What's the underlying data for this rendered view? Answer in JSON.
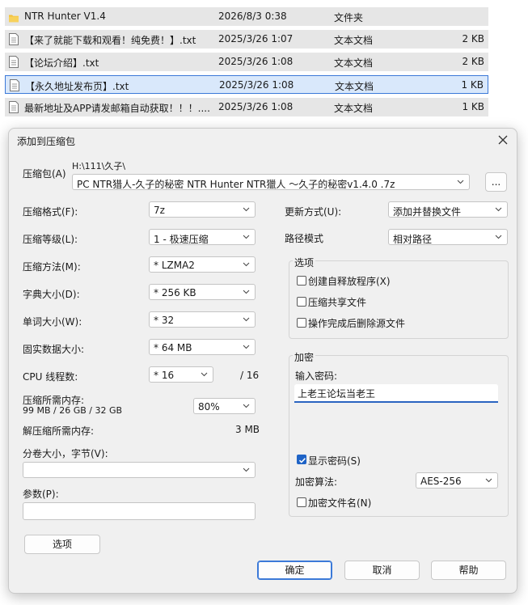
{
  "files": [
    {
      "name": "NTR Hunter V1.4",
      "date": "2026/8/3 0:38",
      "type": "文件夹",
      "size": "",
      "icon": "folder-icon"
    },
    {
      "name": "【来了就能下载和观看！纯免费！】.txt",
      "date": "2025/3/26 1:07",
      "type": "文本文档",
      "size": "2 KB",
      "icon": "text-file-icon"
    },
    {
      "name": "【论坛介绍】.txt",
      "date": "2025/3/26 1:08",
      "type": "文本文档",
      "size": "2 KB",
      "icon": "text-file-icon"
    },
    {
      "name": "【永久地址发布页】.txt",
      "date": "2025/3/26 1:08",
      "type": "文本文档",
      "size": "1 KB",
      "icon": "text-file-icon"
    },
    {
      "name": "最新地址及APP请发邮箱自动获取！！！....",
      "date": "2025/3/26 1:08",
      "type": "文本文档",
      "size": "1 KB",
      "icon": "text-file-icon"
    }
  ],
  "dialog": {
    "title": "添加到压缩包",
    "archive_label": "压缩包(A)",
    "archive_path": "H:\\111\\久子\\",
    "archive_name": "PC NTR猎人-久子的秘密 NTR Hunter NTR獵人 ～久子的秘密v1.4.0 .7z",
    "browse_label": "...",
    "format_label": "压缩格式(F):",
    "format_value": "7z",
    "level_label": "压缩等级(L):",
    "level_value": "1 - 极速压缩",
    "method_label": "压缩方法(M):",
    "method_value": "* LZMA2",
    "dict_label": "字典大小(D):",
    "dict_value": "* 256 KB",
    "word_label": "单词大小(W):",
    "word_value": "* 32",
    "solid_label": "固实数据大小:",
    "solid_value": "* 64 MB",
    "threads_label": "CPU 线程数:",
    "threads_value": "* 16",
    "threads_max": "/ 16",
    "mem_label": "压缩所需内存:",
    "mem_value": "99 MB / 26 GB / 32 GB",
    "mem_percent": "80%",
    "decomp_label": "解压缩所需内存:",
    "decomp_value": "3 MB",
    "volume_label": "分卷大小，字节(V):",
    "params_label": "参数(P):",
    "options_button": "选项",
    "update_label": "更新方式(U):",
    "update_value": "添加并替换文件",
    "pathmode_label": "路径模式",
    "pathmode_value": "相对路径",
    "options_group": "选项",
    "opt_sfx": "创建自释放程序(X)",
    "opt_shared": "压缩共享文件",
    "opt_delete": "操作完成后删除源文件",
    "encrypt_group": "加密",
    "password_label": "输入密码:",
    "password_value": "上老王论坛当老王",
    "show_password": "显示密码(S)",
    "enc_method_label": "加密算法:",
    "enc_method_value": "AES-256",
    "encrypt_names": "加密文件名(N)",
    "ok": "确定",
    "cancel": "取消",
    "help": "帮助"
  }
}
